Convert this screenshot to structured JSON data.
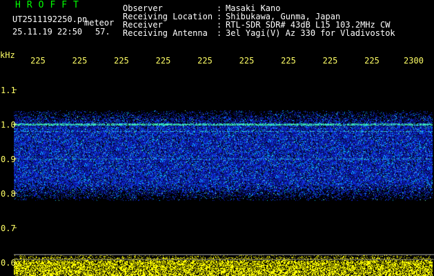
{
  "app": {
    "title": "HROFFT",
    "filename": "UT2511192250.pn",
    "tag": "meteor",
    "datetime": "25.11.19 22:50",
    "count": "57."
  },
  "info": [
    {
      "label": "Observer",
      "value": "Masaki Kano"
    },
    {
      "label": "Receiving Location",
      "value": "Shibukawa, Gunma, Japan"
    },
    {
      "label": "Receiver",
      "value": "RTL-SDR SDR# 43dB L15 103.2MHz CW"
    },
    {
      "label": "Receiving Antenna",
      "value": "3el Yagi(V) Az 330 for Vladivostok"
    }
  ],
  "chart_data": {
    "type": "heatmap",
    "ylabel": "kHz",
    "y_ticks": [
      "1.1",
      "1.0",
      "0.9",
      "0.8",
      "0.7",
      "0.6"
    ],
    "x_ticks": [
      "225",
      "225",
      "225",
      "225",
      "225",
      "225",
      "225",
      "225",
      "225",
      "2300"
    ],
    "colors": {
      "text": "#ffff66",
      "signal": "#1030ff",
      "noise": "#ffff00"
    }
  }
}
